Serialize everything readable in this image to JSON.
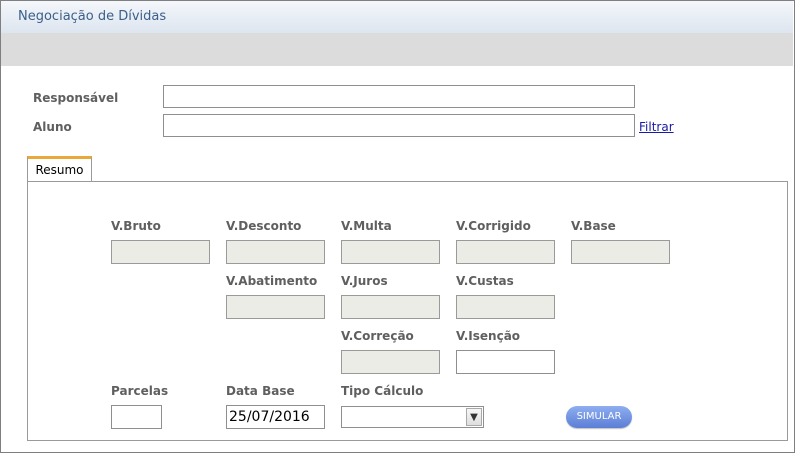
{
  "window": {
    "title": "Negociação de Dívidas"
  },
  "filters": {
    "responsavel_label": "Responsável",
    "responsavel_value": "",
    "aluno_label": "Aluno",
    "aluno_value": "",
    "filter_link": "Filtrar"
  },
  "tabs": [
    {
      "label": "Resumo",
      "active": true
    }
  ],
  "resumo": {
    "v_bruto": {
      "label": "V.Bruto",
      "value": ""
    },
    "v_desconto": {
      "label": "V.Desconto",
      "value": ""
    },
    "v_multa": {
      "label": "V.Multa",
      "value": ""
    },
    "v_corrigido": {
      "label": "V.Corrigido",
      "value": ""
    },
    "v_base": {
      "label": "V.Base",
      "value": ""
    },
    "v_abatimento": {
      "label": "V.Abatimento",
      "value": ""
    },
    "v_juros": {
      "label": "V.Juros",
      "value": ""
    },
    "v_custas": {
      "label": "V.Custas",
      "value": ""
    },
    "v_correcao": {
      "label": "V.Correção",
      "value": ""
    },
    "v_isencao": {
      "label": "V.Isenção",
      "value": ""
    },
    "parcelas": {
      "label": "Parcelas",
      "value": ""
    },
    "data_base": {
      "label": "Data Base",
      "value": "25/07/2016"
    },
    "tipo_calculo": {
      "label": "Tipo Cálculo",
      "selected": ""
    },
    "simular_label": "SIMULAR"
  },
  "colors": {
    "title_text": "#3b5f8a",
    "tab_accent": "#e8a93a",
    "readonly_bg": "#ecece6",
    "button_bg": "#6f8fe0",
    "link": "#1a1aa6"
  }
}
